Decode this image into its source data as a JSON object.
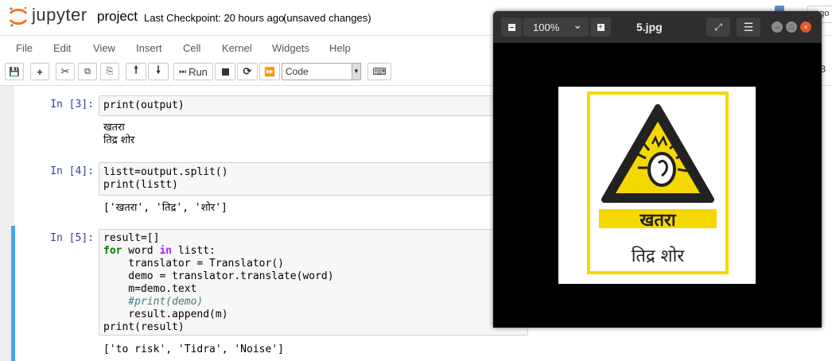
{
  "header": {
    "logo_text": "jupyter",
    "notebook_name": "project",
    "checkpoint": "Last Checkpoint: 20 hours ago",
    "status": "(unsaved changes)",
    "login_fragment": "ogo"
  },
  "menubar": {
    "items": [
      "File",
      "Edit",
      "View",
      "Insert",
      "Cell",
      "Kernel",
      "Widgets",
      "Help"
    ]
  },
  "toolbar": {
    "run_label": "Run",
    "cell_type": "Code",
    "kernel_fragment": "n 3"
  },
  "cells": [
    {
      "prompt": "In [3]:",
      "code": "print(output)",
      "output_lines": [
        "खतरा",
        "तिद्र शोर"
      ]
    },
    {
      "prompt": "In [4]:",
      "code_lines": [
        "listt=output.split()",
        "print(listt)"
      ],
      "output": "['खतरा', 'तिद्र', 'शोर']"
    },
    {
      "prompt": "In [5]:",
      "code_lines": [
        "result=[]",
        "for word in listt:",
        "    translator = Translator()",
        "    demo = translator.translate(word)",
        "    m=demo.text",
        "    #print(demo)",
        "    result.append(m)",
        "print(result)"
      ],
      "output": "['to risk', 'Tidra', 'Noise']"
    }
  ],
  "viewer": {
    "zoom": "100%",
    "title": "5.jpg",
    "image": {
      "text_top": "खतरा",
      "text_bottom": "तिद्र शोर",
      "colors": {
        "yellow": "#f5d800",
        "black": "#222222",
        "white": "#ffffff"
      }
    }
  },
  "colors": {
    "prompt_in": "#303f9f",
    "selected_cell_bar": "#42a5f5",
    "keyword": "#008000",
    "comment": "#408080"
  }
}
